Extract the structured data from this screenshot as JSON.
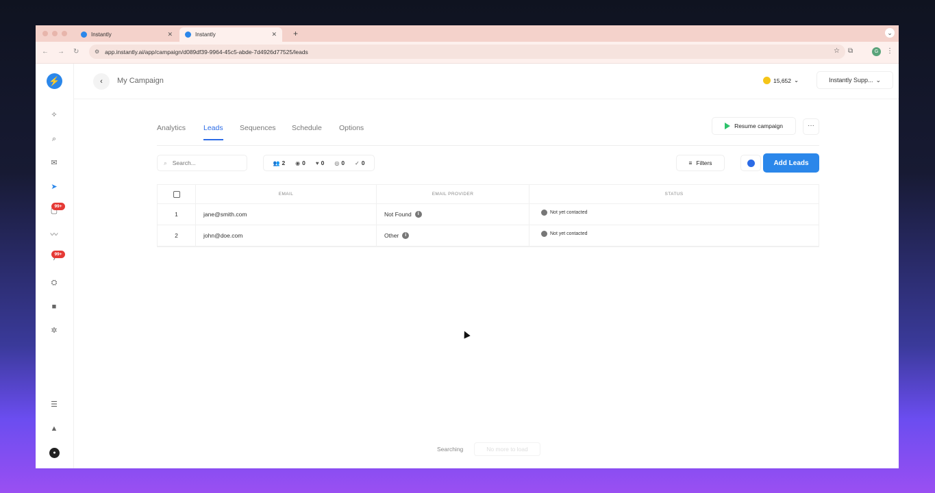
{
  "browser": {
    "tabs": [
      {
        "label": "Instantly"
      },
      {
        "label": "Instantly"
      }
    ],
    "url": "app.instantly.ai/app/campaign/d089df39-9964-45c5-abde-7d4926d77525/leads",
    "profile_initial": "G"
  },
  "sidebar": {
    "badges": [
      "99+",
      "99+"
    ]
  },
  "header": {
    "campaign_name": "My Campaign",
    "credits": "15,652",
    "workspace": "Instantly Supp..."
  },
  "tabs": [
    {
      "label": "Analytics"
    },
    {
      "label": "Leads"
    },
    {
      "label": "Sequences"
    },
    {
      "label": "Schedule"
    },
    {
      "label": "Options"
    }
  ],
  "actions": {
    "resume_label": "Resume campaign",
    "filters_label": "Filters",
    "add_leads_label": "Add Leads"
  },
  "search": {
    "placeholder": "Search..."
  },
  "counts": [
    "2",
    "0",
    "0",
    "0",
    "0"
  ],
  "table": {
    "columns": [
      "EMAIL",
      "EMAIL PROVIDER",
      "STATUS"
    ],
    "rows": [
      {
        "index": "1",
        "email": "jane@smith.com",
        "provider": "Not Found",
        "status": "Not yet contacted"
      },
      {
        "index": "2",
        "email": "john@doe.com",
        "provider": "Other",
        "status": "Not yet contacted"
      }
    ]
  },
  "footer": {
    "searching": "Searching",
    "no_more": "No more to load"
  },
  "colors": {
    "accent": "#2b87ea",
    "badge": "#e53935",
    "tab_active": "#2b6be6"
  }
}
